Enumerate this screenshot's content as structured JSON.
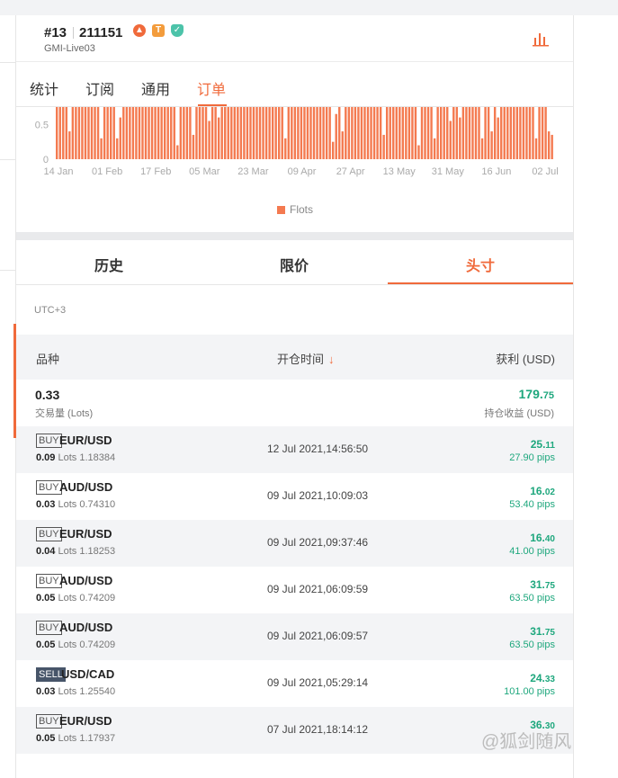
{
  "header": {
    "rank": "#13",
    "account": "211151",
    "server": "GMI-Live03",
    "icons": [
      "flame-icon",
      "t-badge-icon",
      "shield-icon",
      "bar-chart-icon"
    ],
    "t_badge": "T"
  },
  "tabs": [
    {
      "label": "统计",
      "active": false
    },
    {
      "label": "订阅",
      "active": false
    },
    {
      "label": "通用",
      "active": false
    },
    {
      "label": "订单",
      "active": true
    }
  ],
  "chart_data": {
    "type": "bar",
    "title": "",
    "x_tick_labels": [
      "14 Jan",
      "01 Feb",
      "17 Feb",
      "05 Mar",
      "23 Mar",
      "09 Apr",
      "27 Apr",
      "13 May",
      "31 May",
      "16 Jun",
      "02 Jul"
    ],
    "y_tick_labels": [
      "0",
      "0.5"
    ],
    "ylim": [
      0,
      0.75
    ],
    "legend": [
      {
        "name": "Flots",
        "color": "#f47a50"
      }
    ],
    "series": [
      {
        "name": "Flots",
        "color": "#f47a50",
        "values": [
          0.75,
          0.75,
          0.75,
          0.75,
          0.4,
          0.75,
          0.75,
          0.75,
          0.75,
          0.75,
          0.75,
          0.75,
          0.75,
          0.75,
          0.3,
          0.75,
          0.75,
          0.75,
          0.75,
          0.3,
          0.6,
          0.75,
          0.75,
          0.75,
          0.75,
          0.75,
          0.75,
          0.75,
          0.75,
          0.75,
          0.75,
          0.75,
          0.75,
          0.75,
          0.75,
          0.75,
          0.75,
          0.75,
          0.2,
          0.75,
          0.75,
          0.75,
          0.75,
          0.35,
          0.75,
          0.75,
          0.75,
          0.75,
          0.55,
          0.75,
          0.75,
          0.6,
          0.75,
          0.75,
          0.75,
          0.75,
          0.75,
          0.75,
          0.75,
          0.75,
          0.75,
          0.75,
          0.75,
          0.75,
          0.75,
          0.75,
          0.75,
          0.75,
          0.75,
          0.75,
          0.75,
          0.75,
          0.3,
          0.75,
          0.75,
          0.75,
          0.75,
          0.75,
          0.75,
          0.75,
          0.75,
          0.75,
          0.75,
          0.75,
          0.75,
          0.75,
          0.75,
          0.25,
          0.65,
          0.75,
          0.4,
          0.75,
          0.75,
          0.75,
          0.75,
          0.75,
          0.75,
          0.75,
          0.75,
          0.75,
          0.75,
          0.75,
          0.75,
          0.35,
          0.75,
          0.75,
          0.75,
          0.75,
          0.75,
          0.75,
          0.75,
          0.75,
          0.75,
          0.75,
          0.2,
          0.75,
          0.75,
          0.75,
          0.75,
          0.3,
          0.75,
          0.75,
          0.75,
          0.75,
          0.55,
          0.75,
          0.75,
          0.6,
          0.75,
          0.75,
          0.75,
          0.75,
          0.75,
          0.75,
          0.3,
          0.75,
          0.75,
          0.4,
          0.75,
          0.6,
          0.75,
          0.75,
          0.75,
          0.75,
          0.75,
          0.75,
          0.75,
          0.75,
          0.75,
          0.75,
          0.75,
          0.3,
          0.75,
          0.75,
          0.75,
          0.4,
          0.35
        ]
      }
    ],
    "grid": false,
    "legend_position": "bottom-center"
  },
  "subtabs": [
    {
      "label": "历史",
      "active": false
    },
    {
      "label": "限价",
      "active": false
    },
    {
      "label": "头寸",
      "active": true
    }
  ],
  "timezone": "UTC+3",
  "table": {
    "col_symbol": "品种",
    "col_open_time": "开仓时间",
    "col_open_time_arrow": "↓",
    "col_profit": "获利 (USD)"
  },
  "summary": {
    "lots": "0.33",
    "lots_label": "交易量 (Lots)",
    "profit_int": "179.",
    "profit_dec": "75",
    "profit_label": "持仓收益 (USD)"
  },
  "positions": [
    {
      "side": "BUY",
      "symbol": "EUR/USD",
      "lots": "0.09",
      "lots_unit": "Lots",
      "price": "1.18384",
      "time": "12 Jul 2021,14:56:50",
      "profit_int": "25.",
      "profit_dec": "11",
      "pips": "27.90 pips"
    },
    {
      "side": "BUY",
      "symbol": "AUD/USD",
      "lots": "0.03",
      "lots_unit": "Lots",
      "price": "0.74310",
      "time": "09 Jul 2021,10:09:03",
      "profit_int": "16.",
      "profit_dec": "02",
      "pips": "53.40 pips"
    },
    {
      "side": "BUY",
      "symbol": "EUR/USD",
      "lots": "0.04",
      "lots_unit": "Lots",
      "price": "1.18253",
      "time": "09 Jul 2021,09:37:46",
      "profit_int": "16.",
      "profit_dec": "40",
      "pips": "41.00 pips"
    },
    {
      "side": "BUY",
      "symbol": "AUD/USD",
      "lots": "0.05",
      "lots_unit": "Lots",
      "price": "0.74209",
      "time": "09 Jul 2021,06:09:59",
      "profit_int": "31.",
      "profit_dec": "75",
      "pips": "63.50 pips"
    },
    {
      "side": "BUY",
      "symbol": "AUD/USD",
      "lots": "0.05",
      "lots_unit": "Lots",
      "price": "0.74209",
      "time": "09 Jul 2021,06:09:57",
      "profit_int": "31.",
      "profit_dec": "75",
      "pips": "63.50 pips"
    },
    {
      "side": "SELL",
      "symbol": "USD/CAD",
      "lots": "0.03",
      "lots_unit": "Lots",
      "price": "1.25540",
      "time": "09 Jul 2021,05:29:14",
      "profit_int": "24.",
      "profit_dec": "33",
      "pips": "101.00 pips"
    },
    {
      "side": "BUY",
      "symbol": "EUR/USD",
      "lots": "0.05",
      "lots_unit": "Lots",
      "price": "1.17937",
      "time": "07 Jul 2021,18:14:12",
      "profit_int": "36.",
      "profit_dec": "30",
      "pips": ""
    }
  ],
  "watermark": "@狐剑随风",
  "colors": {
    "accent": "#f06a3b",
    "bar": "#f47a50",
    "profit": "#1ea77d"
  }
}
